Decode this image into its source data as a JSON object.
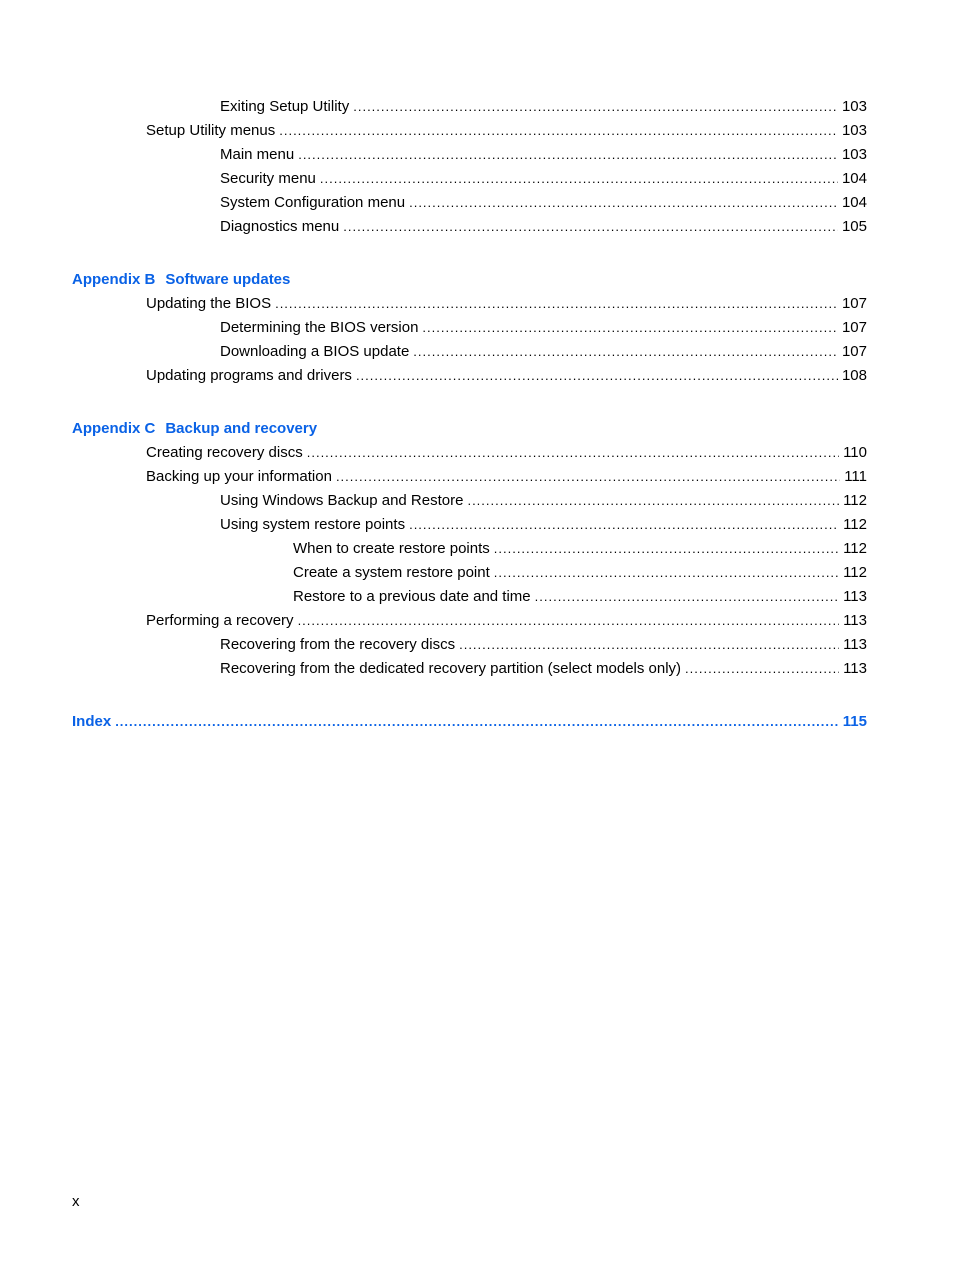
{
  "toc": {
    "top_entries": [
      {
        "title": "Exiting Setup Utility",
        "page": "103",
        "level": 2
      },
      {
        "title": "Setup Utility menus",
        "page": "103",
        "level": 1
      },
      {
        "title": "Main menu",
        "page": "103",
        "level": 2
      },
      {
        "title": "Security menu",
        "page": "104",
        "level": 2
      },
      {
        "title": "System Configuration menu",
        "page": "104",
        "level": 2
      },
      {
        "title": "Diagnostics menu",
        "page": "105",
        "level": 2
      }
    ],
    "appendix_b": {
      "label": "Appendix B",
      "title": "Software updates",
      "entries": [
        {
          "title": "Updating the BIOS",
          "page": "107",
          "level": 1
        },
        {
          "title": "Determining the BIOS version",
          "page": "107",
          "level": 2
        },
        {
          "title": "Downloading a BIOS update",
          "page": "107",
          "level": 2
        },
        {
          "title": "Updating programs and drivers",
          "page": "108",
          "level": 1
        }
      ]
    },
    "appendix_c": {
      "label": "Appendix C",
      "title": "Backup and recovery",
      "entries": [
        {
          "title": "Creating recovery discs",
          "page": "110",
          "level": 1
        },
        {
          "title": "Backing up your information",
          "page": "111",
          "level": 1
        },
        {
          "title": "Using Windows Backup and Restore",
          "page": "112",
          "level": 2
        },
        {
          "title": "Using system restore points",
          "page": "112",
          "level": 2
        },
        {
          "title": "When to create restore points",
          "page": "112",
          "level": 3
        },
        {
          "title": "Create a system restore point",
          "page": "112",
          "level": 3
        },
        {
          "title": "Restore to a previous date and time",
          "page": "113",
          "level": 3
        },
        {
          "title": "Performing a recovery",
          "page": "113",
          "level": 1
        },
        {
          "title": "Recovering from the recovery discs",
          "page": "113",
          "level": 2
        },
        {
          "title": "Recovering from the dedicated recovery partition (select models only)",
          "page": "113",
          "level": 2
        }
      ]
    },
    "index": {
      "title": "Index",
      "page": "115"
    }
  },
  "footer": {
    "page_number": "x"
  },
  "colors": {
    "heading": "#0a62e6",
    "text": "#000000"
  }
}
